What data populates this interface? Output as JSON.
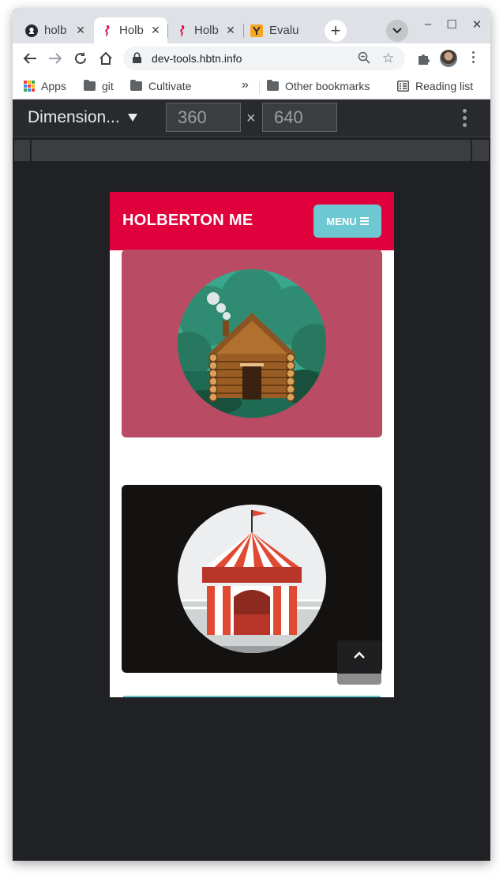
{
  "browser": {
    "tabs": [
      {
        "title": "holb",
        "icon": "github-icon",
        "active": false
      },
      {
        "title": "Holb",
        "icon": "holberton-seahorse-icon",
        "active": true
      },
      {
        "title": "Holb",
        "icon": "holberton-seahorse-icon",
        "active": false
      },
      {
        "title": "Evalu",
        "icon": "y-combinator-icon",
        "active": false
      }
    ],
    "tab_close_glyph": "✕",
    "new_tab_glyph": "+",
    "window_controls": {
      "minimize": "–",
      "maximize": "☐",
      "close": "✕"
    },
    "address": "dev-tools.hbtn.info",
    "bookmarks": {
      "apps": "Apps",
      "items": [
        "git",
        "Cultivate"
      ],
      "overflow": "»",
      "other": "Other bookmarks",
      "reading_list": "Reading list"
    }
  },
  "devtools": {
    "device": "Dimension...",
    "width": "360",
    "height": "640",
    "times": "×"
  },
  "page": {
    "brand": "HOLBERTON ME",
    "menu_label": "MENU",
    "cards": [
      {
        "illustration": "log-cabin-illustration",
        "background": "#b94b65"
      },
      {
        "illustration": "circus-tent-illustration",
        "background": "#141111"
      }
    ],
    "back_to_top_icon": "chevron-up-icon"
  },
  "colors": {
    "header": "#e0003c",
    "menu_button": "#6ec8d2",
    "devtools_bg": "#202124"
  }
}
